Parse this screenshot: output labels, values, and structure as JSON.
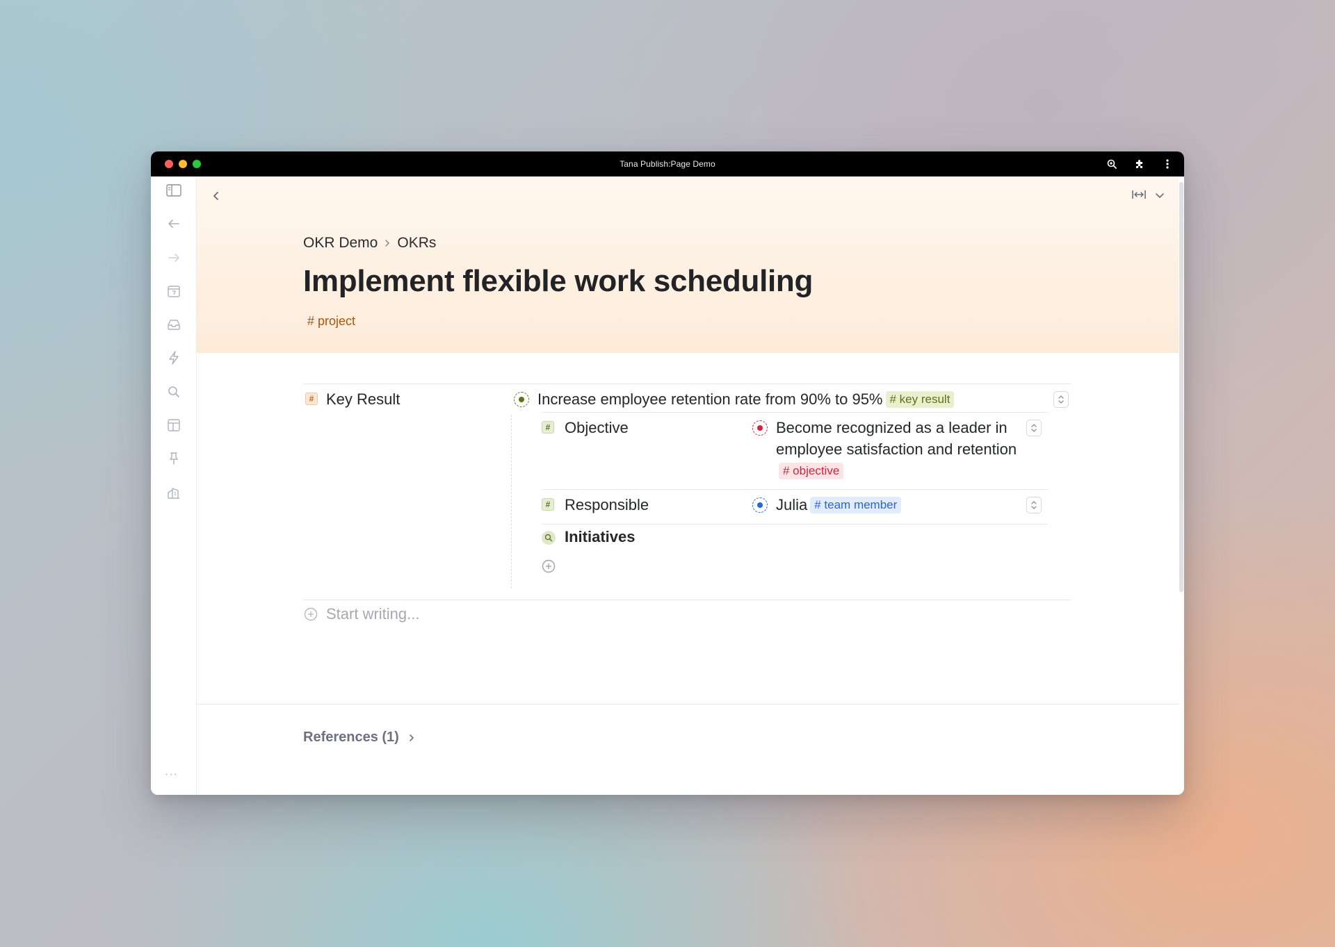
{
  "window": {
    "title": "Tana Publish:Page Demo",
    "traffic_colors": [
      "#ff5f57",
      "#febc2e",
      "#28c840"
    ]
  },
  "sidebar": {
    "icons": [
      "panel-toggle-icon",
      "arrow-left-icon",
      "arrow-right-icon",
      "calendar-icon",
      "inbox-icon",
      "lightning-icon",
      "search-icon",
      "layout-icon",
      "pin-icon",
      "workspace-icon"
    ],
    "more_label": "···"
  },
  "header": {
    "breadcrumb": [
      "OKR Demo",
      "OKRs"
    ],
    "title": "Implement flexible work scheduling",
    "tag": "# project"
  },
  "fields": {
    "key_result": {
      "name": "Key Result",
      "value": "Increase employee retention rate from 90% to 95%",
      "tag": "# key result",
      "bullet_color": "#5c7514"
    },
    "objective": {
      "name": "Objective",
      "value": "Become recognized as a leader in employee satisfaction and retention",
      "tag": "# objective",
      "bullet_color": "#d1253b"
    },
    "responsible": {
      "name": "Responsible",
      "value": "Julia",
      "tag": "# team member",
      "bullet_color": "#2a64d8"
    },
    "initiatives": {
      "name": "Initiatives"
    }
  },
  "editor": {
    "placeholder": "Start writing..."
  },
  "references": {
    "label": "References (1)"
  },
  "colors": {
    "project_tag": "#a8560c",
    "hero_bg": "#fdebd8"
  }
}
